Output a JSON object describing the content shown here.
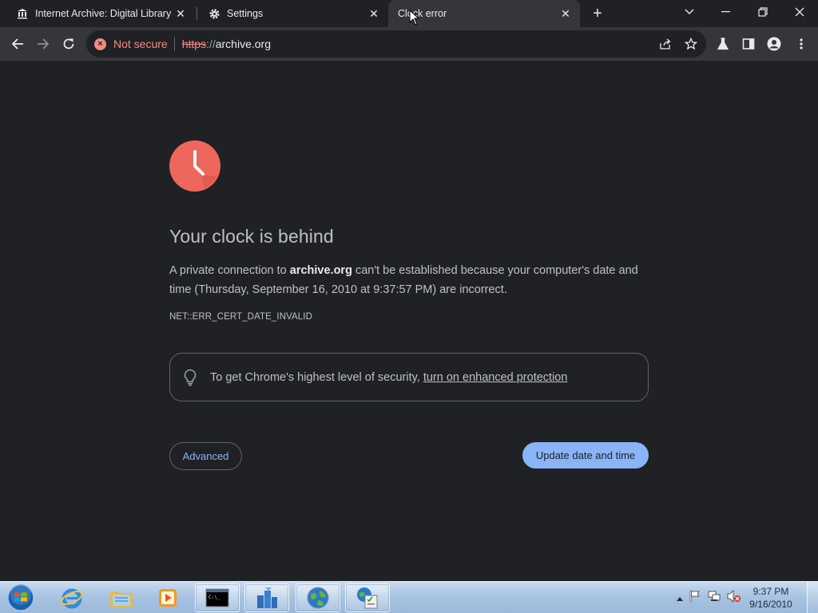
{
  "browser": {
    "tabs": [
      {
        "title": "Internet Archive: Digital Library of Free & Borrowable Books, Movies, Music & Wayback Machine",
        "icon": "museum-icon",
        "active": false
      },
      {
        "title": "Settings",
        "icon": "gear-icon",
        "active": false
      },
      {
        "title": "Clock error",
        "icon": "",
        "active": true
      }
    ],
    "omnibox": {
      "security_label": "Not secure",
      "url_scheme": "https",
      "url_separator": "://",
      "url_host": "archive.org"
    }
  },
  "page": {
    "heading": "Your clock is behind",
    "desc_prefix": "A private connection to ",
    "desc_host": "archive.org",
    "desc_suffix": " can't be established because your computer's date and time (Thursday, September 16, 2010 at 9:37:57 PM) are incorrect.",
    "error_code": "NET::ERR_CERT_DATE_INVALID",
    "enhanced_prefix": "To get Chrome's highest level of security, ",
    "enhanced_link": "turn on enhanced protection",
    "advanced_button": "Advanced",
    "update_button": "Update date and time",
    "accent_color": "#8ab4f8",
    "error_color": "#f28b82"
  },
  "taskbar": {
    "apps": [
      "internet-explorer-icon",
      "windows-explorer-icon",
      "media-player-icon",
      "command-prompt-icon",
      "network-app-icon",
      "globe-app-icon",
      "control-panel-icon"
    ],
    "clock_time": "9:37 PM",
    "clock_date": "9/16/2010"
  }
}
